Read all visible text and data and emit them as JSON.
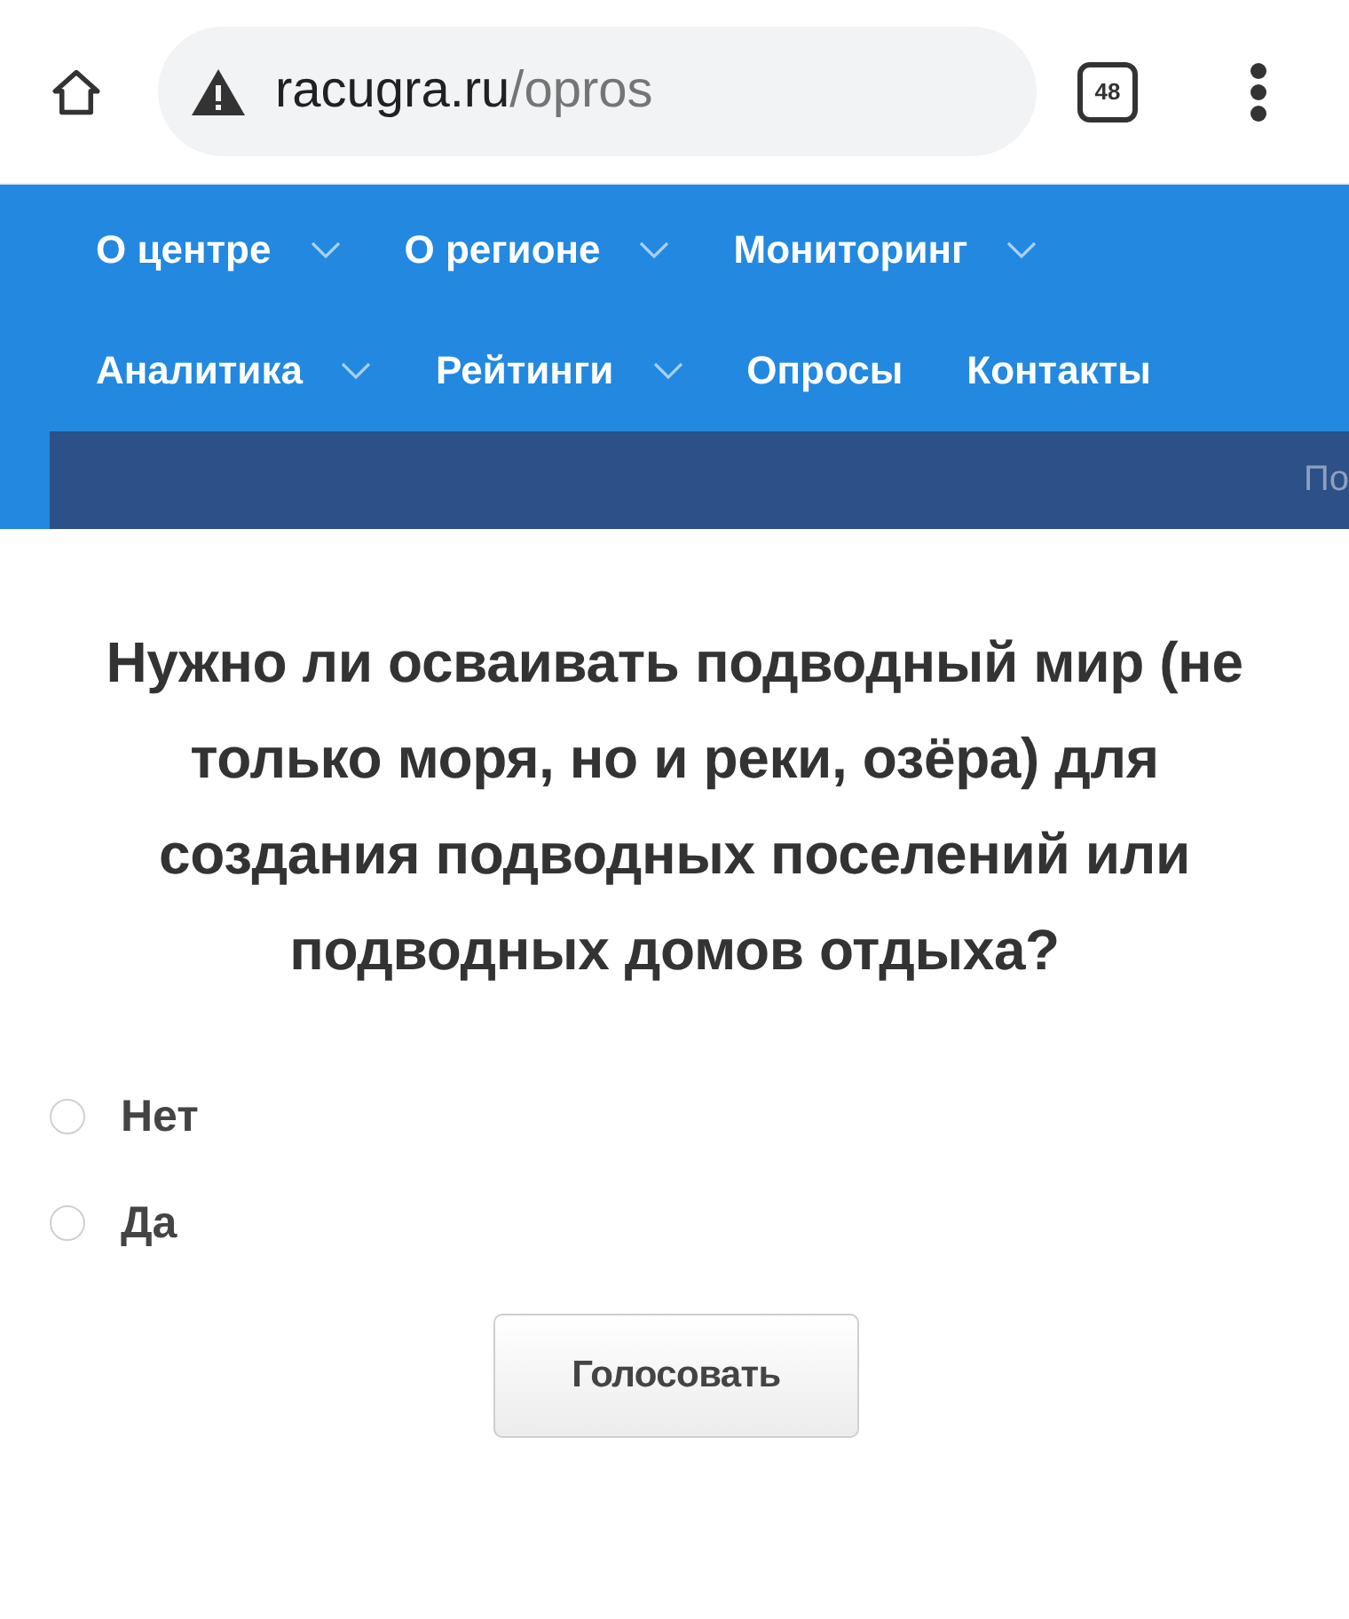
{
  "browser": {
    "url": {
      "host": "racugra.ru",
      "path": "/opros"
    },
    "tab_count": "48"
  },
  "nav": {
    "items": [
      {
        "label": "О центре",
        "kind": "dropdown"
      },
      {
        "label": "О регионе",
        "kind": "dropdown"
      },
      {
        "label": "Мониторинг",
        "kind": "dropdown"
      },
      {
        "label": "Аналитика",
        "kind": "dropdown"
      },
      {
        "label": "Рейтинги",
        "kind": "dropdown"
      },
      {
        "label": "Опросы",
        "kind": "link"
      },
      {
        "label": "Контакты",
        "kind": "link"
      }
    ],
    "search": {
      "placeholder": "По"
    }
  },
  "poll": {
    "question": "Нужно ли осваивать подводный мир (не только моря, но и реки, озёра) для создания подводных поселений или подводных домов отдыха?",
    "options": [
      {
        "label": "Нет",
        "selected": false
      },
      {
        "label": "Да",
        "selected": false
      }
    ],
    "submit": "Голосовать"
  }
}
